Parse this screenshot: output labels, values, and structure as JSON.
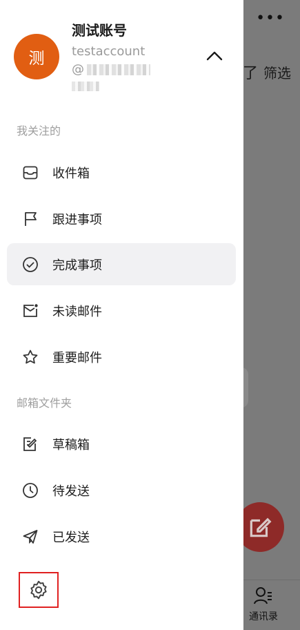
{
  "background": {
    "more_label": "•••",
    "filter_symbol": "了",
    "filter_label": "筛选",
    "contacts_label": "通讯录"
  },
  "account": {
    "avatar_char": "测",
    "name": "测试账号",
    "username": "testaccount",
    "at_prefix": "@"
  },
  "sections": {
    "following": "我关注的",
    "folders": "邮箱文件夹"
  },
  "following_items": [
    {
      "label": "收件箱",
      "icon": "inbox-icon"
    },
    {
      "label": "跟进事项",
      "icon": "flag-icon"
    },
    {
      "label": "完成事项",
      "icon": "check-circle-icon",
      "active": true
    },
    {
      "label": "未读邮件",
      "icon": "unread-mail-icon"
    },
    {
      "label": "重要邮件",
      "icon": "star-icon"
    }
  ],
  "folder_items": [
    {
      "label": "草稿箱",
      "icon": "draft-icon"
    },
    {
      "label": "待发送",
      "icon": "clock-icon"
    },
    {
      "label": "已发送",
      "icon": "send-icon"
    }
  ],
  "colors": {
    "avatar": "#e15e12",
    "active_bg": "#f1f1f3",
    "highlight": "#e02020",
    "fab": "#8e2a28"
  }
}
